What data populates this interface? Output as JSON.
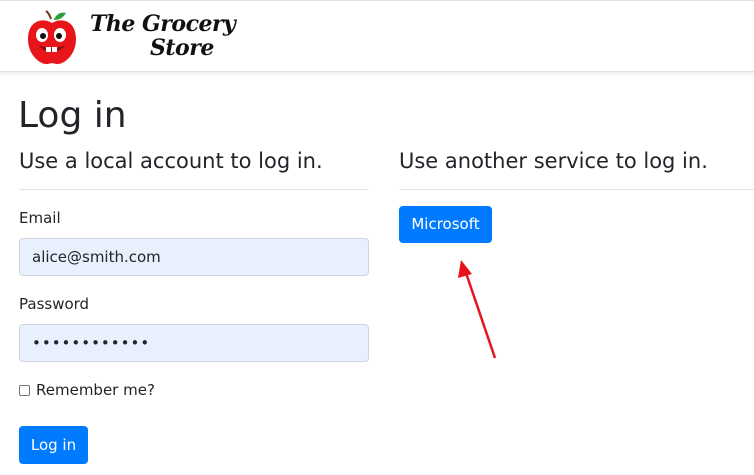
{
  "brand": {
    "line1": "The Grocery",
    "line2": "Store"
  },
  "page": {
    "title": "Log in"
  },
  "local": {
    "heading": "Use a local account to log in.",
    "email_label": "Email",
    "email_value": "alice@smith.com",
    "password_label": "Password",
    "password_value": "••••••••••••",
    "remember_label": "Remember me?",
    "login_button": "Log in"
  },
  "external": {
    "heading": "Use another service to log in.",
    "microsoft_button": "Microsoft"
  },
  "colors": {
    "primary": "#007bff",
    "autofill": "#e8f0fe",
    "annotation_arrow": "#e8141c"
  }
}
